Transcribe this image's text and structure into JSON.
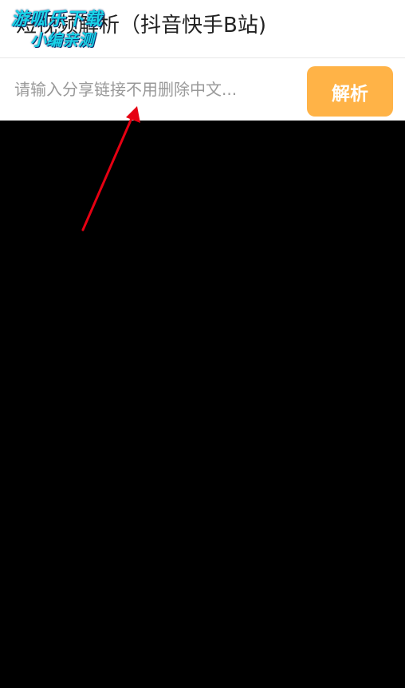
{
  "header": {
    "title": "短视频解析（抖音快手B站)"
  },
  "watermark": {
    "line1": "游呱乐下载",
    "line2": "小编亲测"
  },
  "input_bar": {
    "placeholder": "请输入分享链接不用删除中文...",
    "value": "",
    "button_label": "解析"
  },
  "colors": {
    "button": "#ffb347",
    "watermark": "#19d3e6",
    "arrow": "#e60012",
    "content_background": "#000000"
  },
  "annotation": {
    "icon": "red-arrow-icon"
  }
}
